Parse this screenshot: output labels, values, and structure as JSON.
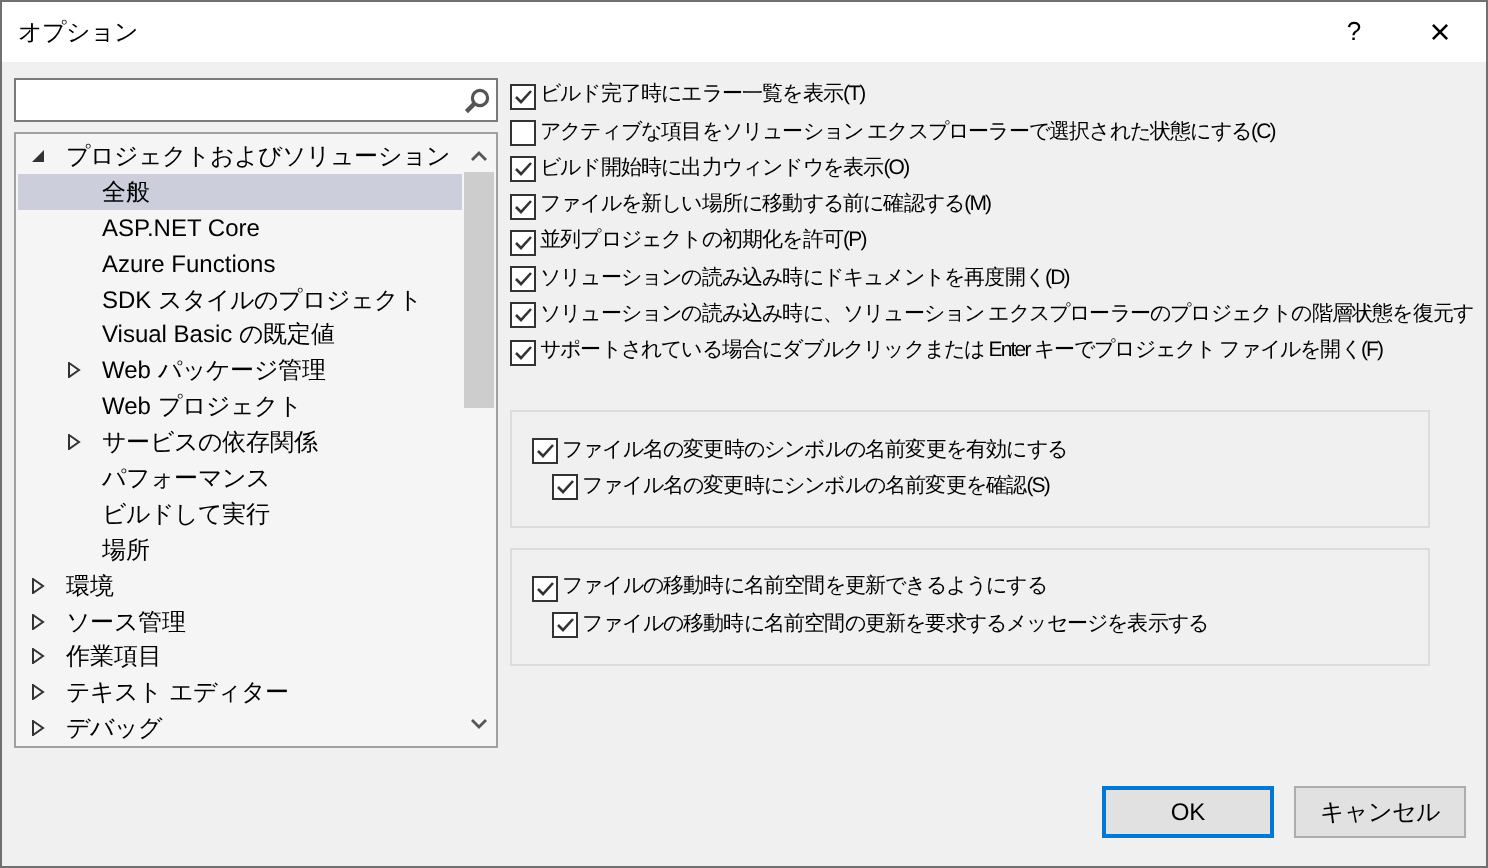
{
  "window": {
    "title": "オプション",
    "help": "?",
    "close": "×"
  },
  "tree": [
    {
      "label": "プロジェクトおよびソリューション",
      "expanded": true,
      "selected": false,
      "children": [
        {
          "label": "全般",
          "selected": true
        },
        {
          "label": "ASP.NET Core",
          "selected": false
        },
        {
          "label": "Azure Functions",
          "selected": false
        },
        {
          "label": "SDK スタイルのプロジェクト",
          "selected": false
        },
        {
          "label": "Visual Basic の既定値",
          "selected": false
        },
        {
          "label": "Web パッケージ管理",
          "expanded": false,
          "selected": false
        },
        {
          "label": "Web プロジェクト",
          "selected": false
        },
        {
          "label": "サービスの依存関係",
          "expanded": false,
          "selected": false
        },
        {
          "label": "パフォーマンス",
          "selected": false
        },
        {
          "label": "ビルドして実行",
          "selected": false
        },
        {
          "label": "場所",
          "selected": false
        }
      ]
    },
    {
      "label": "環境",
      "expanded": false,
      "selected": false
    },
    {
      "label": "ソース管理",
      "expanded": false,
      "selected": false
    },
    {
      "label": "作業項目",
      "expanded": false,
      "selected": false
    },
    {
      "label": "テキスト エディター",
      "expanded": false,
      "selected": false
    },
    {
      "label": "デバッグ",
      "expanded": false,
      "selected": false
    }
  ],
  "options": [
    {
      "label": "ビルド完了時にエラー一覧を表示(T)",
      "checked": true
    },
    {
      "label": "アクティブな項目をソリューション エクスプローラーで選択された状態にする(C)",
      "checked": false
    },
    {
      "label": "ビルド開始時に出力ウィンドウを表示(O)",
      "checked": true
    },
    {
      "label": "ファイルを新しい場所に移動する前に確認する(M)",
      "checked": true
    },
    {
      "label": "並列プロジェクトの初期化を許可(P)",
      "checked": true
    },
    {
      "label": "ソリューションの読み込み時にドキュメントを再度開く(D)",
      "checked": true
    },
    {
      "label": "ソリューションの読み込み時に、ソリューション エクスプローラーのプロジェクトの階層状態を復元す",
      "checked": true
    },
    {
      "label": "サポートされている場合にダブルクリックまたは Enter キーでプロジェクト ファイルを開く(F)",
      "checked": true
    }
  ],
  "groups": [
    {
      "items": [
        {
          "label": "ファイル名の変更時のシンボルの名前変更を有効にする",
          "checked": true,
          "children": [
            {
              "label": "ファイル名の変更時にシンボルの名前変更を確認(S)",
              "checked": true
            }
          ]
        }
      ]
    },
    {
      "items": [
        {
          "label": "ファイルの移動時に名前空間を更新できるようにする",
          "checked": true,
          "children": [
            {
              "label": "ファイルの移動時に名前空間の更新を要求するメッセージを表示する",
              "checked": true
            }
          ]
        }
      ]
    }
  ],
  "buttons": [
    {
      "label": "OK",
      "default": true
    },
    {
      "label": "キャンセル",
      "default": false
    }
  ]
}
